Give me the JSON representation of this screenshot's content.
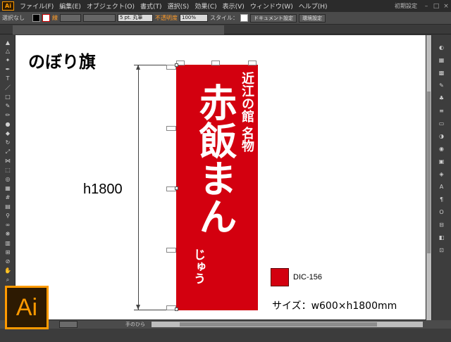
{
  "app": {
    "logo": "Ai"
  },
  "menubar": {
    "items": [
      "ファイル(F)",
      "編集(E)",
      "オブジェクト(O)",
      "書式(T)",
      "選択(S)",
      "効果(C)",
      "表示(V)",
      "ウィンドウ(W)",
      "ヘルプ(H)"
    ],
    "workspace": "初期設定",
    "window_controls": [
      "–",
      "□",
      "×"
    ]
  },
  "controlbar": {
    "selection_label": "選択なし",
    "stroke_label": "線",
    "brush_value": "5 pt. 丸筆",
    "opacity_label": "不透明度",
    "opacity_value": "100%",
    "style_label": "スタイル：",
    "document_setup_button": "ドキュメント設定",
    "preferences_button": "環境設定"
  },
  "document_tab": {
    "title": "　"
  },
  "statusbar": {
    "zoom": "",
    "tool_name": "手のひら"
  },
  "canvas": {
    "title": "のぼり旗",
    "height_label": "h1800",
    "banner_subtitle": "近江の館 名物",
    "banner_main": "赤飯まん",
    "banner_small": "じゅう",
    "color_name": "DIC-156",
    "size_label": "サイズ：w600×h1800mm"
  },
  "badge": {
    "text": "Ai"
  },
  "colors": {
    "banner_red": "#d3000f",
    "ai_orange": "#ff9a00",
    "ai_dark": "#2d1a02"
  }
}
